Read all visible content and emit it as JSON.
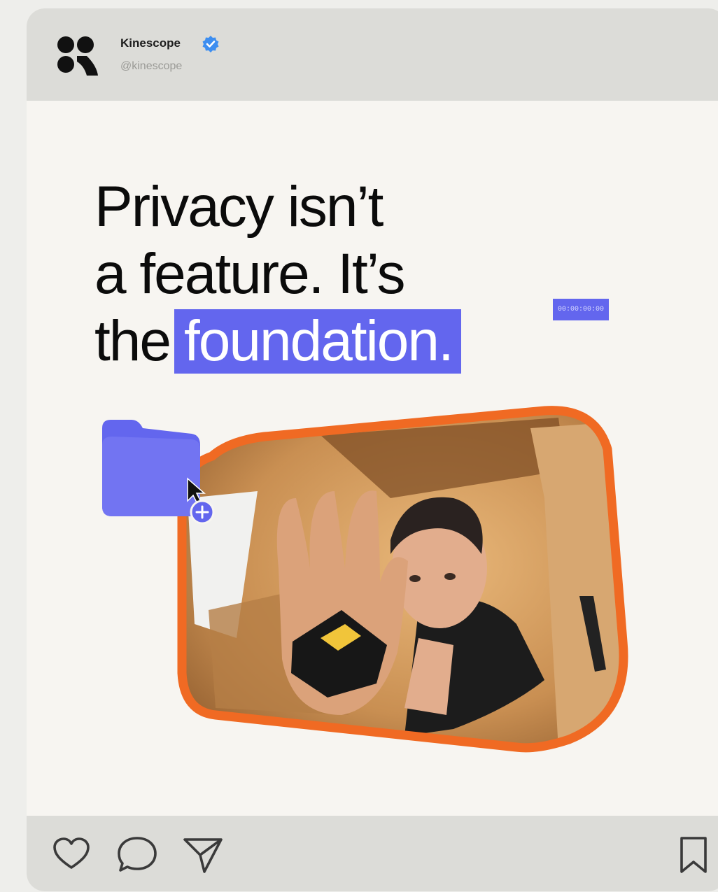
{
  "post": {
    "account_name": "Kinescope",
    "account_handle": "@kinescope",
    "verified": true,
    "headline_line1": "Privacy isn’t",
    "headline_line2": "a feature. It’s",
    "headline_line3_plain": "the",
    "headline_line3_highlight": "foundation.",
    "timecode": "00:00:00:00"
  },
  "actions": {
    "like_icon": "heart-icon",
    "comment_icon": "speech-bubble-icon",
    "share_icon": "paper-plane-icon",
    "save_icon": "bookmark-icon"
  },
  "colors": {
    "accent": "#6366ee",
    "frame": "#f06a23",
    "verified": "#3d8ef0",
    "header_bg": "#dcdcd8",
    "card_bg": "#f7f5f1"
  }
}
